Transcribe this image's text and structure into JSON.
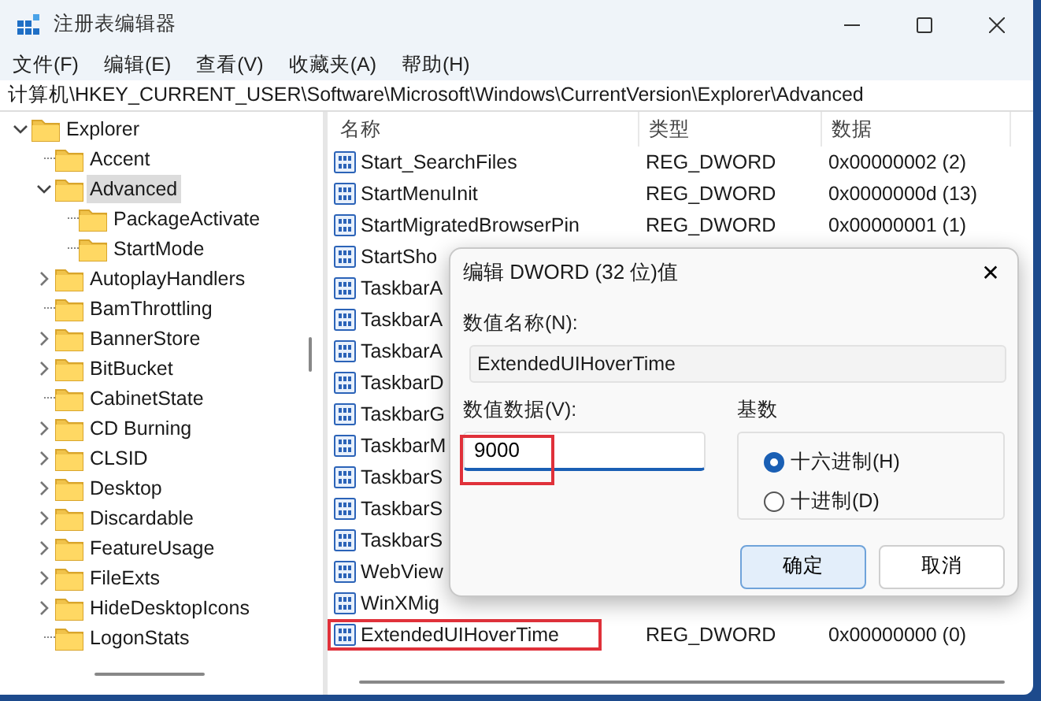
{
  "window": {
    "title": "注册表编辑器"
  },
  "menu": [
    "文件(F)",
    "编辑(E)",
    "查看(V)",
    "收藏夹(A)",
    "帮助(H)"
  ],
  "address": "计算机\\HKEY_CURRENT_USER\\Software\\Microsoft\\Windows\\CurrentVersion\\Explorer\\Advanced",
  "tree": [
    {
      "label": "Explorer",
      "expandable": true,
      "expanded": true,
      "selected": false,
      "children": [
        {
          "label": "Accent",
          "expandable": false,
          "selected": false
        },
        {
          "label": "Advanced",
          "expandable": true,
          "expanded": true,
          "selected": true,
          "children": [
            {
              "label": "PackageActivate",
              "expandable": false,
              "selected": false
            },
            {
              "label": "StartMode",
              "expandable": false,
              "selected": false
            }
          ]
        },
        {
          "label": "AutoplayHandlers",
          "expandable": true,
          "expanded": false,
          "selected": false
        },
        {
          "label": "BamThrottling",
          "expandable": false,
          "selected": false
        },
        {
          "label": "BannerStore",
          "expandable": true,
          "expanded": false,
          "selected": false
        },
        {
          "label": "BitBucket",
          "expandable": true,
          "expanded": false,
          "selected": false
        },
        {
          "label": "CabinetState",
          "expandable": false,
          "selected": false
        },
        {
          "label": "CD Burning",
          "expandable": true,
          "expanded": false,
          "selected": false
        },
        {
          "label": "CLSID",
          "expandable": true,
          "expanded": false,
          "selected": false
        },
        {
          "label": "Desktop",
          "expandable": true,
          "expanded": false,
          "selected": false
        },
        {
          "label": "Discardable",
          "expandable": true,
          "expanded": false,
          "selected": false
        },
        {
          "label": "FeatureUsage",
          "expandable": true,
          "expanded": false,
          "selected": false
        },
        {
          "label": "FileExts",
          "expandable": true,
          "expanded": false,
          "selected": false
        },
        {
          "label": "HideDesktopIcons",
          "expandable": true,
          "expanded": false,
          "selected": false
        },
        {
          "label": "LogonStats",
          "expandable": false,
          "selected": false
        }
      ]
    }
  ],
  "values": {
    "columns": [
      "名称",
      "类型",
      "数据"
    ],
    "rows": [
      {
        "name": "Start_SearchFiles",
        "type": "REG_DWORD",
        "data": "0x00000002 (2)",
        "highlighted": false
      },
      {
        "name": "StartMenuInit",
        "type": "REG_DWORD",
        "data": "0x0000000d (13)",
        "highlighted": false
      },
      {
        "name": "StartMigratedBrowserPin",
        "type": "REG_DWORD",
        "data": "0x00000001 (1)",
        "highlighted": false
      },
      {
        "name": "StartSho",
        "highlighted": false
      },
      {
        "name": "TaskbarA",
        "highlighted": false
      },
      {
        "name": "TaskbarA",
        "highlighted": false
      },
      {
        "name": "TaskbarA",
        "highlighted": false
      },
      {
        "name": "TaskbarD",
        "highlighted": false
      },
      {
        "name": "TaskbarG",
        "highlighted": false
      },
      {
        "name": "TaskbarM",
        "highlighted": false
      },
      {
        "name": "TaskbarS",
        "highlighted": false
      },
      {
        "name": "TaskbarS",
        "highlighted": false
      },
      {
        "name": "TaskbarS",
        "highlighted": false
      },
      {
        "name": "WebView",
        "highlighted": false
      },
      {
        "name": "WinXMig",
        "highlighted": false
      },
      {
        "name": "ExtendedUIHoverTime",
        "type": "REG_DWORD",
        "data": "0x00000000 (0)",
        "highlighted": true
      }
    ]
  },
  "dialog": {
    "title": "编辑 DWORD (32 位)值",
    "close": "✕",
    "name_label": "数值名称(N):",
    "name_value": "ExtendedUIHoverTime",
    "data_label": "数值数据(V):",
    "data_value": "9000",
    "data_highlighted": true,
    "base_label": "基数",
    "bases": [
      {
        "label": "十六进制(H)",
        "selected": true
      },
      {
        "label": "十进制(D)",
        "selected": false
      }
    ],
    "buttons": [
      {
        "label": "确定",
        "primary": true
      },
      {
        "label": "取消",
        "primary": false
      }
    ]
  }
}
